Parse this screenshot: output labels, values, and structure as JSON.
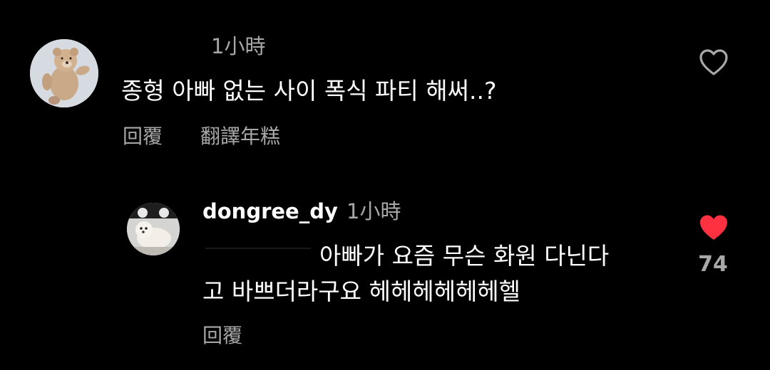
{
  "colors": {
    "background": "#000000",
    "primary_text": "#ffffff",
    "secondary_text": "#a8a8a8",
    "liked_heart": "#ff3040"
  },
  "comments": [
    {
      "avatar_icon": "teddy-bear-avatar",
      "time": "1小時",
      "text": "종형 아빠 없는 사이 폭식 파티 해써..?",
      "reply_label": "回覆",
      "translate_label": "翻譯年糕",
      "like_icon": "heart-outline-icon"
    },
    {
      "avatar_icon": "dog-avatar",
      "username": "dongree_dy",
      "time": "1小時",
      "text_line1": "아빠가 요즘 무슨 화원 다닌다",
      "text_line2": "고 바쁘더라구요 헤헤헤헤헤헤헬",
      "reply_label": "回覆",
      "like_icon": "heart-filled-icon",
      "like_count": "74"
    }
  ]
}
